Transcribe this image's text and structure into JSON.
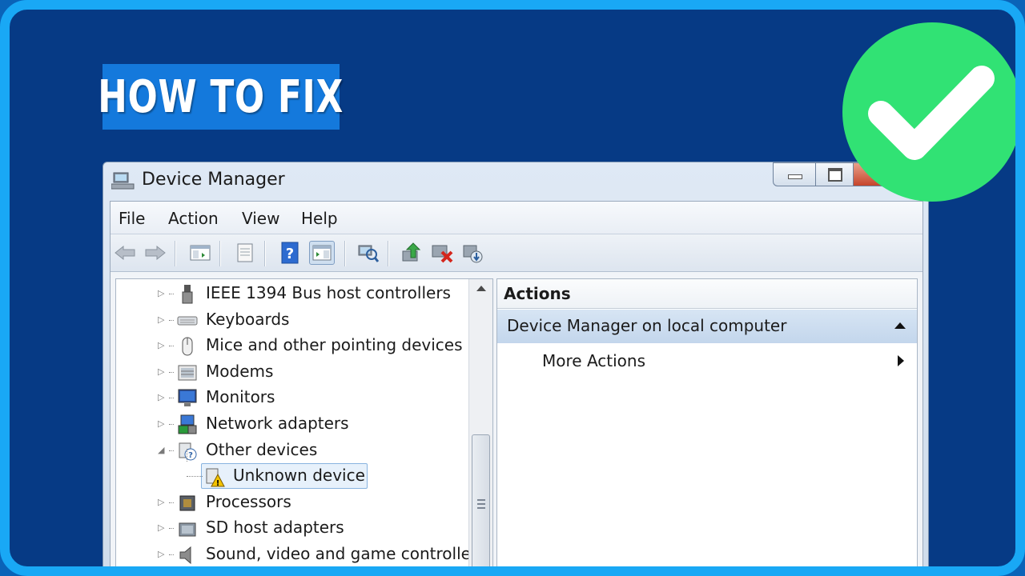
{
  "banner": {
    "title": "HOW TO FIX"
  },
  "window": {
    "title": "Device Manager",
    "menu": [
      "File",
      "Action",
      "View",
      "Help"
    ],
    "toolbar_icons": [
      "back-arrow-icon",
      "forward-arrow-icon",
      "show-hide-console-tree-icon",
      "properties-icon",
      "help-icon",
      "show-hide-action-pane-icon",
      "scan-hardware-icon",
      "update-driver-icon",
      "uninstall-device-icon",
      "add-legacy-hardware-icon"
    ]
  },
  "tree": {
    "items": [
      {
        "label": "IEEE 1394 Bus host controllers",
        "icon": "firewire-icon",
        "expanded": false
      },
      {
        "label": "Keyboards",
        "icon": "keyboard-icon",
        "expanded": false
      },
      {
        "label": "Mice and other pointing devices",
        "icon": "mouse-icon",
        "expanded": false
      },
      {
        "label": "Modems",
        "icon": "modem-icon",
        "expanded": false
      },
      {
        "label": "Monitors",
        "icon": "monitor-icon",
        "expanded": false
      },
      {
        "label": "Network adapters",
        "icon": "network-adapter-icon",
        "expanded": false
      },
      {
        "label": "Other devices",
        "icon": "unknown-device-category-icon",
        "expanded": true
      },
      {
        "label": "Unknown device",
        "icon": "warning-device-icon",
        "child": true,
        "selected": true
      },
      {
        "label": "Processors",
        "icon": "processor-icon",
        "expanded": false
      },
      {
        "label": "SD host adapters",
        "icon": "sd-card-icon",
        "expanded": false
      },
      {
        "label": "Sound, video and game controller",
        "icon": "speaker-icon",
        "expanded": false
      }
    ]
  },
  "actions": {
    "header": "Actions",
    "group": "Device Manager on local computer",
    "more": "More Actions"
  },
  "colors": {
    "background": "#063a85",
    "frame_border": "#19a8f5",
    "banner": "#1479dc",
    "check": "#31e274"
  }
}
